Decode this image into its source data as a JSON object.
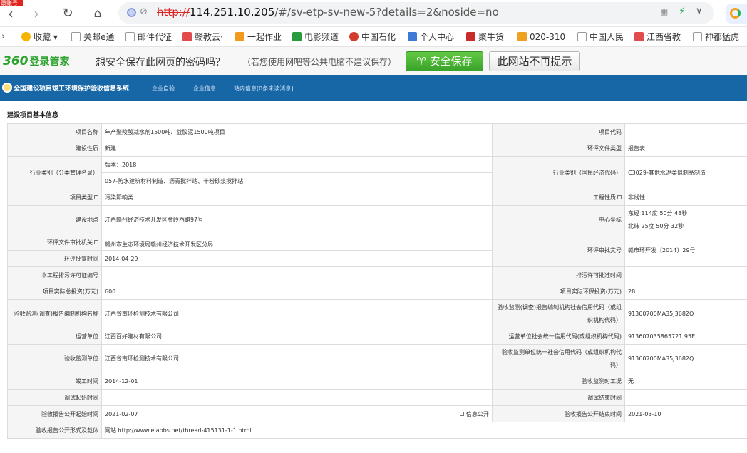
{
  "browser": {
    "badge": "录账号",
    "url_scheme": "http://",
    "url_host": "114.251.10.205",
    "url_path": "/#/sv-etp-sv-new-5?details=2&noside=no"
  },
  "bookmarks": [
    {
      "label": "收藏",
      "color": "#f5b400"
    },
    {
      "label": "关邮e通",
      "color": "#dddddd"
    },
    {
      "label": "邮件代征",
      "color": "#dddddd"
    },
    {
      "label": "赣教云·",
      "color": "#e24b4b"
    },
    {
      "label": "一起作业",
      "color": "#f29a1e"
    },
    {
      "label": "电影频道",
      "color": "#2a9b3c"
    },
    {
      "label": "中国石化",
      "color": "#d33b2a"
    },
    {
      "label": "个人中心",
      "color": "#3d7ad6"
    },
    {
      "label": "聚牛货",
      "color": "#c92b2b"
    },
    {
      "label": "020-310",
      "color": "#f0a020"
    },
    {
      "label": "中国人民",
      "color": "#dddddd"
    },
    {
      "label": "江西省教",
      "color": "#e24b4b"
    },
    {
      "label": "神都猛虎",
      "color": "#dddddd"
    }
  ],
  "password_bar": {
    "logo_num": "360",
    "logo_text": "登录管家",
    "question": "想安全保存此网页的密码吗？",
    "note": "（若您使用网吧等公共电脑不建议保存）",
    "save_button": "安全保存",
    "never_button": "此网站不再提示"
  },
  "site": {
    "title": "全国建设项目竣工环境保护验收信息系统",
    "nav": [
      "企业自验",
      "企业信息",
      "站内信息[0条未读消息]"
    ]
  },
  "section_title": "建设项目基本信息",
  "fields": {
    "project_name_label": "项目名称",
    "project_name": "年产聚羧酸减水剂1500吨、益胶泥1500吨项目",
    "project_code_label": "项目代码",
    "project_code": "",
    "construction_nature_label": "建设性质",
    "construction_nature": "新建",
    "eia_doc_type_label": "环评文件类型",
    "eia_doc_type": "报告表",
    "industry_catalog_label": "行业类别（分类管理名录）",
    "industry_catalog_version": "版本：2018",
    "industry_catalog_value": "057-防水建筑材料制造、沥青搅拌站、干粉砂浆搅拌站",
    "industry_econ_label": "行业类别（国民经济代码）",
    "industry_econ_value": "C3029-其他水泥类似制品制造",
    "project_type_label": "项目类型",
    "project_type": "污染影响类",
    "engineering_nature_label": "工程性质",
    "engineering_nature": "非线性",
    "location_label": "建设地点",
    "location": "江西赣州经济技术开发区金岭西路97号",
    "center_coord_label": "中心坐标",
    "longitude": "东经 114度 50分 48秒",
    "latitude": "北纬 25度 50分 32秒",
    "approval_org_label": "环评文件审批机关",
    "approval_org": "赣州市生态环境局赣州经济技术开发区分局",
    "approval_doc_label": "环评审批文号",
    "approval_doc": "赣市环开发〔2014〕29号",
    "approval_time_label": "环评批复时间",
    "approval_time": "2014-04-29",
    "permit_no_label": "本工程排污许可证编号",
    "permit_no": "",
    "permit_time_label": "排污许可批准时间",
    "permit_time": "",
    "total_invest_label": "项目实际总投资(万元)",
    "total_invest": "600",
    "env_invest_label": "项目实际环保投资(万元)",
    "env_invest": "28",
    "report_org_label": "验收监测(调查)报告编制机构名称",
    "report_org": "江西省南环检测技术有限公司",
    "report_org_code_label": "验收监测(调查)报告编制机构社会信用代码（或组织机构代码）",
    "report_org_code": "91360700MA35J3682Q",
    "operator_label": "运营单位",
    "operator": "江西百好建材有限公司",
    "operator_code_label": "运营单位社会统一信用代码(或组织机构代码)",
    "operator_code": "913607035865721 95E",
    "monitor_org_label": "验收监测单位",
    "monitor_org": "江西省南环检测技术有限公司",
    "monitor_org_code_label": "验收监测单位统一社会信用代码（或组织机构代码）",
    "monitor_org_code": "91360700MA35J3682Q",
    "completion_time_label": "竣工时间",
    "completion_time": "2014-12-01",
    "monitor_condition_label": "验收监测时工况",
    "monitor_condition": "无",
    "debug_start_label": "调试起始时间",
    "debug_start": "",
    "debug_end_label": "调试结束时间",
    "debug_end": "",
    "publicity_start_label": "验收报告公开起始时间",
    "publicity_start": "2021-02-07",
    "info_public_label": "信息公开",
    "publicity_end_label": "验收报告公开结束时间",
    "publicity_end": "2021-03-10",
    "publicity_form_label": "验收报告公开形式及载体",
    "publicity_form": "网站  http://www.eiabbs.net/thread-415131-1-1.html"
  }
}
